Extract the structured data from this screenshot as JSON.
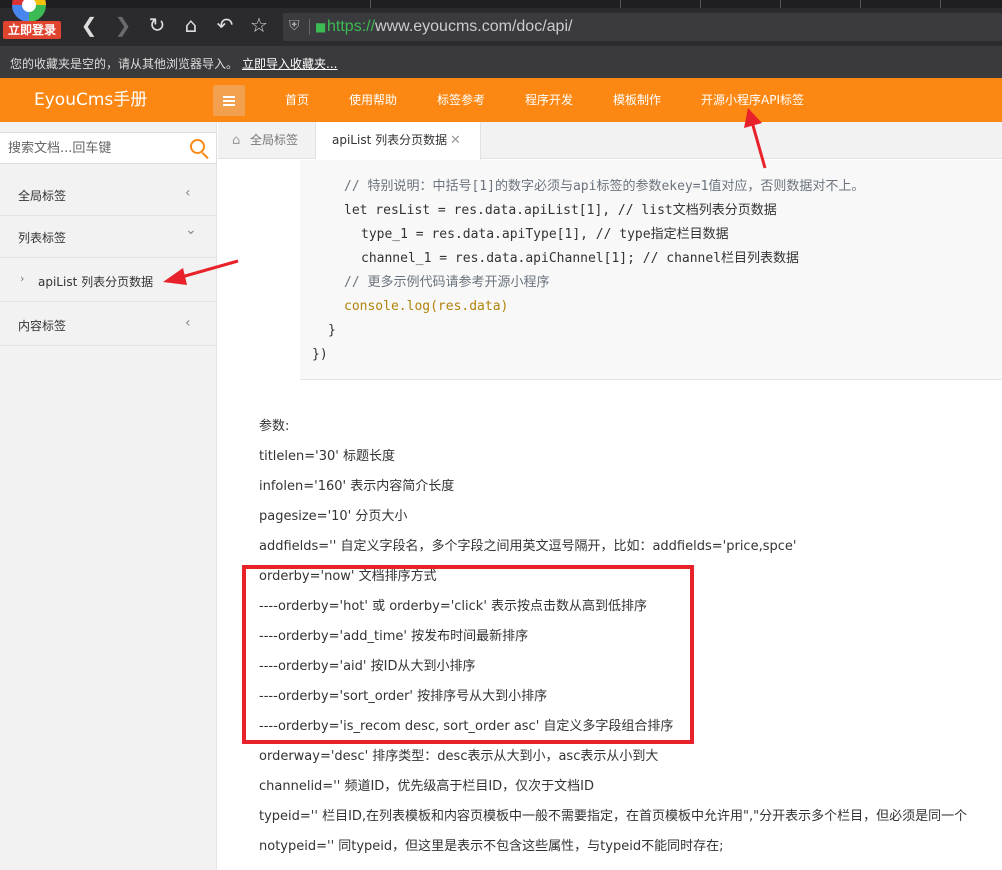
{
  "browser": {
    "login_badge": "立即登录",
    "url_scheme": "https://",
    "url_rest": "www.eyoucms.com/doc/api/",
    "bookmarks_msg": "您的收藏夹是空的，请从其他浏览器导入。",
    "bookmarks_link": "立即导入收藏夹..."
  },
  "header": {
    "logo": "EyouCms手册",
    "nav": [
      "首页",
      "使用帮助",
      "标签参考",
      "程序开发",
      "模板制作",
      "开源小程序API标签"
    ]
  },
  "sidebar": {
    "search_placeholder": "搜索文档...回车键",
    "items": [
      {
        "label": "全局标签",
        "chevron": "‹"
      },
      {
        "label": "列表标签",
        "chevron": "⌄"
      },
      {
        "label": "内容标签",
        "chevron": "‹"
      }
    ],
    "sub_item": "apiList 列表分页数据"
  },
  "tabs": {
    "home": "全局标签",
    "active": "apiList 列表分页数据"
  },
  "code": {
    "lines": [
      "// 特别说明：中括号[1]的数字必须与api标签的参数ekey=1值对应，否则数据对不上。",
      "let resList = res.data.apiList[1], // list文档列表分页数据",
      "type_1 = res.data.apiType[1], // type指定栏目数据",
      "channel_1 = res.data.apiChannel[1]; // channel栏目列表数据",
      "// 更多示例代码请参考开源小程序",
      "console.log(res.data)",
      "}",
      "})"
    ]
  },
  "params": {
    "heading": "参数:",
    "lines": [
      "titlelen='30' 标题长度",
      "infolen='160' 表示内容简介长度",
      "pagesize='10' 分页大小",
      "addfields='' 自定义字段名，多个字段之间用英文逗号隔开，比如：addfields='price,spce'",
      "orderby='now' 文档排序方式",
      "----orderby='hot' 或 orderby='click' 表示按点击数从高到低排序",
      "----orderby='add_time' 按发布时间最新排序",
      "----orderby='aid' 按ID从大到小排序",
      "----orderby='sort_order' 按排序号从大到小排序",
      "----orderby='is_recom desc, sort_order asc' 自定义多字段组合排序",
      "orderway='desc' 排序类型：desc表示从大到小，asc表示从小到大",
      "channelid='' 频道ID，优先级高于栏目ID，仅次于文档ID",
      "typeid='' 栏目ID,在列表模板和内容页模板中一般不需要指定，在首页模板中允许用\",\"分开表示多个栏目，但必须是同一个",
      "notypeid='' 同typeid，但这里是表示不包含这些属性，与typeid不能同时存在;"
    ]
  },
  "colors": {
    "brand": "#fc8813",
    "annotation": "#e8222a"
  }
}
